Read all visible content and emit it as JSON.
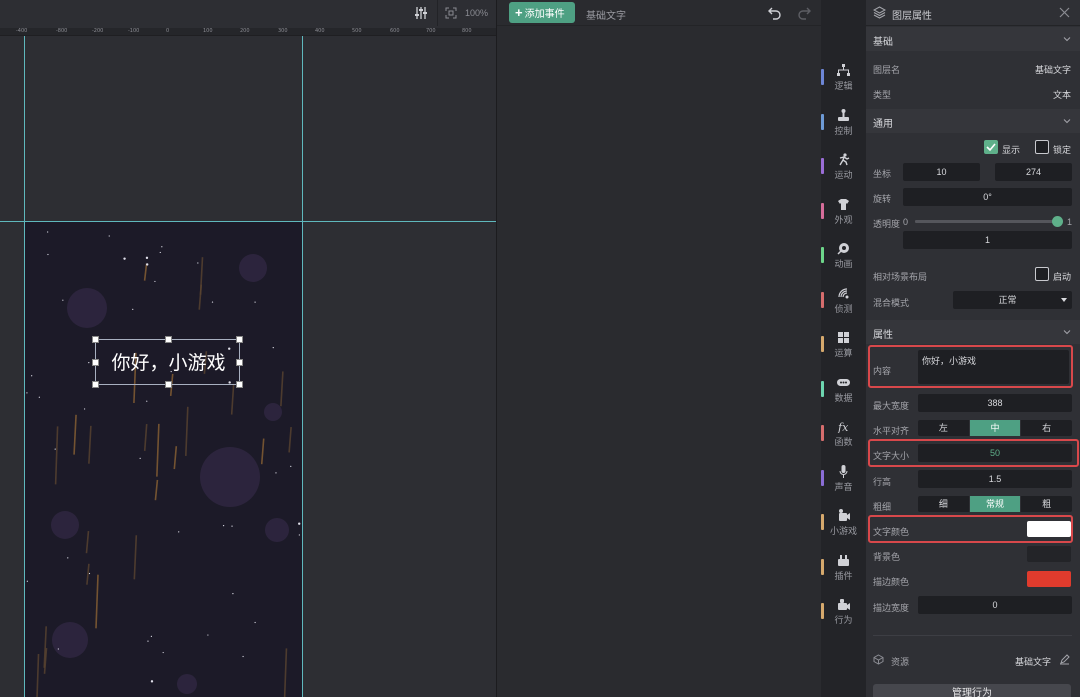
{
  "canvas": {
    "zoom": "100%",
    "ruler_ticks": [
      "-400",
      "-800",
      "-200",
      "-100",
      "0",
      "100",
      "200",
      "300",
      "400",
      "500",
      "600",
      "700",
      "800"
    ],
    "game_text": "你好，小游戏",
    "guide_color": "#5fb8bd"
  },
  "event_editor": {
    "add_event_label": "添加事件",
    "title": "基础文字"
  },
  "categories": [
    {
      "label": "逻辑",
      "icon": "hierarchy-icon",
      "color": "#6d86d6"
    },
    {
      "label": "控制",
      "icon": "joystick-icon",
      "color": "#6d9ad6"
    },
    {
      "label": "运动",
      "icon": "running-icon",
      "color": "#9a6dd6"
    },
    {
      "label": "外观",
      "icon": "shirt-icon",
      "color": "#d66d9a"
    },
    {
      "label": "动画",
      "icon": "animation-icon",
      "color": "#6dd68a"
    },
    {
      "label": "侦测",
      "icon": "signal-icon",
      "color": "#d66d6d"
    },
    {
      "label": "运算",
      "icon": "grid-icon",
      "color": "#d6a96d"
    },
    {
      "label": "数据",
      "icon": "data-icon",
      "color": "#6dd6b0"
    },
    {
      "label": "函数",
      "icon": "fx-icon",
      "color": "#d66d6d"
    },
    {
      "label": "声音",
      "icon": "microphone-icon",
      "color": "#8a6dd6"
    },
    {
      "label": "小游戏",
      "icon": "game-icon",
      "color": "#d6a96d"
    },
    {
      "label": "插件",
      "icon": "plugin-icon",
      "color": "#d6a96d"
    },
    {
      "label": "行为",
      "icon": "behavior-icon",
      "color": "#d6a96d"
    }
  ],
  "props": {
    "header_title": "图层属性",
    "basic": {
      "section": "基础",
      "name_label": "图层名",
      "name_value": "基础文字",
      "type_label": "类型",
      "type_value": "文本"
    },
    "general": {
      "section": "通用",
      "show_label": "显示",
      "lock_label": "锁定",
      "pos_label": "坐标",
      "pos_x": "10",
      "pos_y": "274",
      "rotation_label": "旋转",
      "rotation_value": "0°",
      "opacity_label": "透明度",
      "opacity_min": "0",
      "opacity_max": "1",
      "opacity_value": "1",
      "opacity_fraction": 1,
      "layout_label": "相对场景布局",
      "layout_toggle": "启动",
      "blend_label": "混合模式",
      "blend_value": "正常"
    },
    "attributes": {
      "section": "属性",
      "content_label": "内容",
      "content_value": "你好，小游戏",
      "maxwidth_label": "最大宽度",
      "maxwidth_value": "388",
      "halign_label": "水平对齐",
      "halign_options": [
        "左",
        "中",
        "右"
      ],
      "halign_selected": 1,
      "fontsize_label": "文字大小",
      "fontsize_value": "50",
      "lineheight_label": "行高",
      "lineheight_value": "1.5",
      "weight_label": "粗细",
      "weight_options": [
        "细",
        "常规",
        "粗"
      ],
      "weight_selected": 1,
      "color_label": "文字颜色",
      "color_value": "#ffffff",
      "bg_label": "背景色",
      "bg_value": "#232428",
      "stroke_label": "描边颜色",
      "stroke_value": "#e03b2d",
      "stroke_width_label": "描边宽度",
      "stroke_width_value": "0"
    },
    "resource": {
      "label": "资源",
      "value": "基础文字"
    },
    "manage_button": "管理行为",
    "highlight_color": "#d8484b",
    "accent_color": "#4ea083"
  }
}
